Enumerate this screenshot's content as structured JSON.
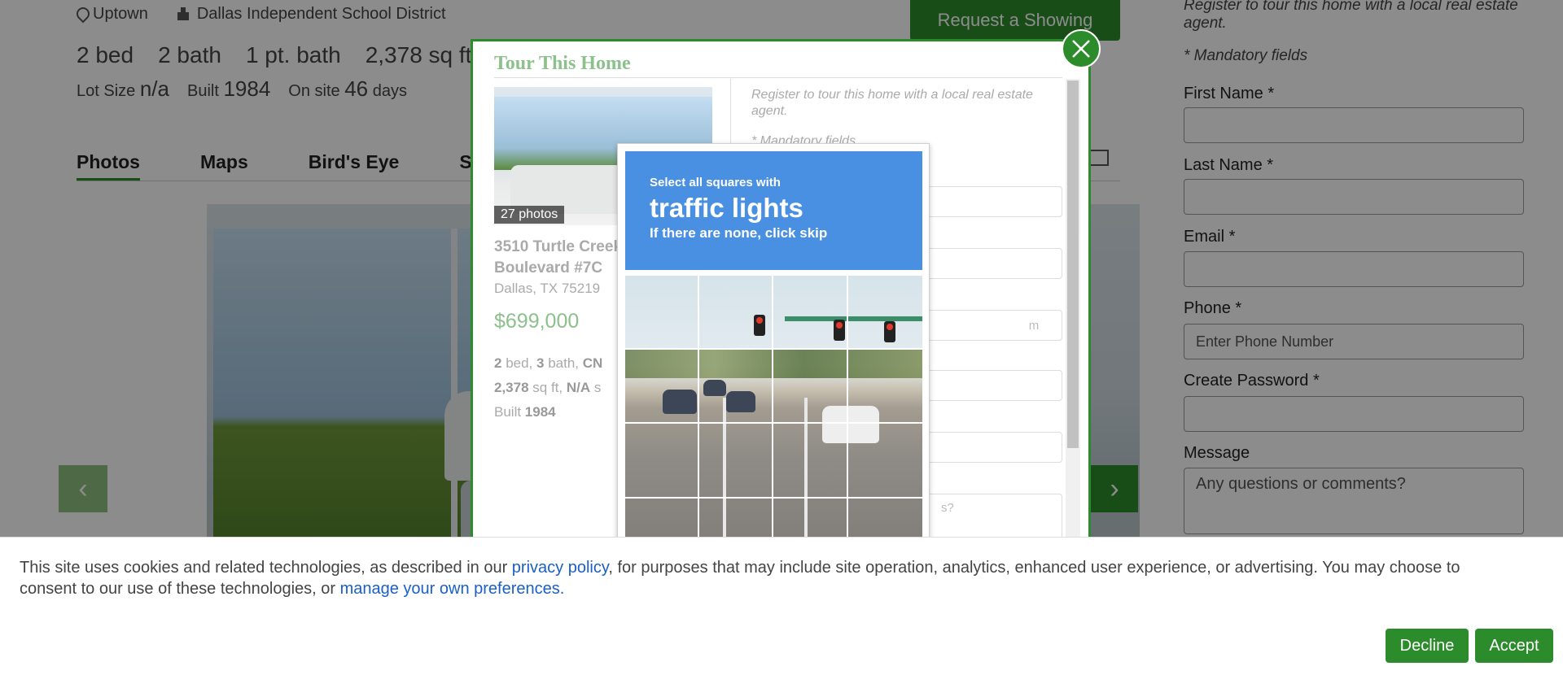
{
  "listing": {
    "neighborhood": "Uptown",
    "school_district": "Dallas Independent School District",
    "request_showing_label": "Request a Showing",
    "stats": {
      "beds": "2 bed",
      "baths": "2 bath",
      "partial_baths": "1 pt. bath",
      "sqft": "2,378 sq ft"
    },
    "lot_size_label": "Lot Size",
    "lot_size_value": "n/a",
    "built_label": "Built",
    "built_value": "1984",
    "on_site_label": "On site",
    "on_site_value": "46",
    "on_site_unit": "days"
  },
  "tabs": [
    {
      "label": "Photos",
      "active": true
    },
    {
      "label": "Maps",
      "active": false
    },
    {
      "label": "Bird's Eye",
      "active": false
    },
    {
      "label": "S",
      "active": false
    }
  ],
  "right_form": {
    "register_text": "Register to tour this home with a local real estate agent.",
    "mandatory_text": "* Mandatory fields",
    "first_name_label": "First Name *",
    "last_name_label": "Last Name *",
    "email_label": "Email *",
    "phone_label": "Phone *",
    "phone_placeholder": "Enter Phone Number",
    "password_label": "Create Password *",
    "message_label": "Message",
    "message_placeholder": "Any questions or comments?"
  },
  "modal": {
    "title": "Tour This Home",
    "photos_badge": "27 photos",
    "address_line1": "3510 Turtle Creek",
    "address_line2": "Boulevard #7C",
    "city": "Dallas, TX 75219",
    "price": "$699,000",
    "spec_line1_beds": "2",
    "spec_line1_beds_unit": " bed, ",
    "spec_line1_baths": "3",
    "spec_line1_baths_unit": " bath, ",
    "spec_line1_type": "CN",
    "spec_line2_sqft": "2,378",
    "spec_line2_unit": " sq ft, ",
    "spec_line2_lot": "N/A",
    "spec_line2_tail": " s",
    "spec_line3_label": "Built ",
    "spec_line3_value": "1984",
    "register_text": "Register to tour this home with a local real estate agent.",
    "mandatory_text": "* Mandatory fields",
    "email_hint": "m",
    "message_hint": "s?"
  },
  "captcha": {
    "line1": "Select all squares with",
    "line2": "traffic lights",
    "line3": "If there are none, click skip"
  },
  "cookie": {
    "text_before": "This site uses cookies and related technologies, as described in our ",
    "privacy_link": "privacy policy",
    "text_middle": ", for purposes that may include site operation, analytics, enhanced user experience, or advertising. You may choose to",
    "text_line2": "consent to our use of these technologies, or ",
    "preferences_link": "manage your own preferences.",
    "decline_label": "Decline",
    "accept_label": "Accept"
  },
  "colors": {
    "brand_green": "#2c8c2c",
    "light_green": "#8cc08c",
    "captcha_blue": "#4a90e2",
    "link_blue": "#1a5fc8"
  },
  "icons": {
    "location": "pin-icon",
    "school": "school-icon",
    "mail": "mail-icon",
    "close": "close-icon",
    "prev": "chevron-left-icon",
    "next": "chevron-right-icon"
  }
}
